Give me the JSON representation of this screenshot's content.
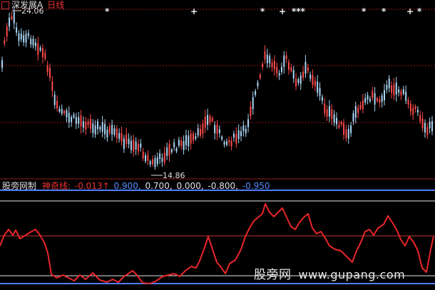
{
  "header": {
    "stock_name": "深发展A",
    "period": "日线"
  },
  "price_panel": {
    "high_label": "24.06",
    "low_label": "14.86",
    "signal_marks": [
      "*",
      "*",
      "+",
      "*",
      "+",
      "***",
      "*",
      "*",
      "+",
      "*"
    ]
  },
  "indicator_panel": {
    "name": "股旁网制",
    "series_label": "神奇线:",
    "current_value": "-0.013",
    "arrow": "↑",
    "levels": [
      {
        "text": "0.900,",
        "color": "#5a8cff"
      },
      {
        "text": "0.700,",
        "color": "#e0e0e0"
      },
      {
        "text": "0.000,",
        "color": "#e0e0e0"
      },
      {
        "text": "-0.800,",
        "color": "#e0e0e0"
      },
      {
        "text": "-0.950",
        "color": "#5a8cff"
      }
    ]
  },
  "watermark": {
    "cn": "股旁网",
    "url": "www.gupang.com"
  },
  "colors": {
    "up": "#ff4a4a",
    "down": "#a9d6f5",
    "grid": "#8b1a1a",
    "line": "#e8262a",
    "blue_level": "#4f7cff",
    "white_level": "#e6e6e6"
  }
}
